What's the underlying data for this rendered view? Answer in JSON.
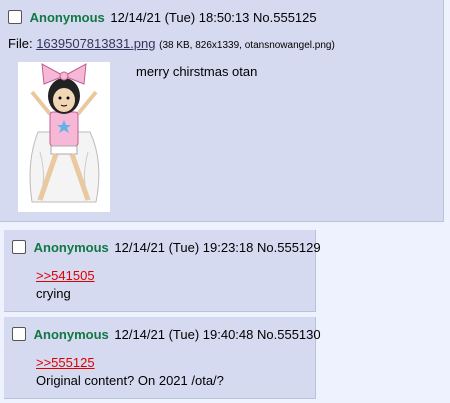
{
  "posts": [
    {
      "name": "Anonymous",
      "datetime": "12/14/21 (Tue) 18:50:13",
      "number": "No.555125",
      "file_label": "File:",
      "file_link": "1639507813831.png",
      "file_meta": "(38 KB, 826x1339, otansnowangel.png)",
      "message": "merry chirstmas otan"
    },
    {
      "name": "Anonymous",
      "datetime": "12/14/21 (Tue) 19:23:18",
      "number": "No.555129",
      "quotelink": ">>541505",
      "message": "crying"
    },
    {
      "name": "Anonymous",
      "datetime": "12/14/21 (Tue) 19:40:48",
      "number": "No.555130",
      "quotelink": ">>555125",
      "message": "Original content? On 2021 /ota/?"
    }
  ],
  "colors": {
    "name": "#117743",
    "quote": "#dd0000",
    "post_bg": "#d6daf0",
    "page_bg": "#eef2ff"
  }
}
